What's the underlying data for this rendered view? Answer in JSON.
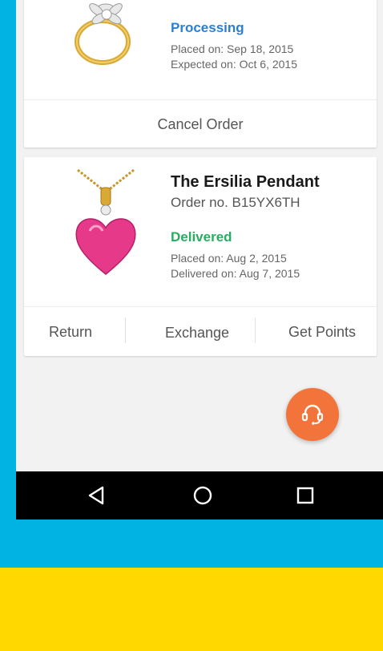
{
  "orders": [
    {
      "status": "Processing",
      "status_color": "#2a7fd4",
      "placed": "Placed on: Sep 18, 2015",
      "expected": "Expected on: Oct 6, 2015",
      "action": "Cancel Order",
      "image_icon": "flower-ring-icon"
    },
    {
      "title": "The Ersilia Pendant",
      "order_no": "Order no. B15YX6TH",
      "status": "Delivered",
      "status_color": "#27ae60",
      "placed": "Placed on: Aug 2, 2015",
      "delivered": "Delivered on: Aug 7, 2015",
      "actions": [
        "Return",
        "Exchange",
        "Get Points"
      ],
      "image_icon": "heart-pendant-icon"
    }
  ],
  "fab_icon": "headset-support-icon",
  "nav": [
    "back-icon",
    "home-icon",
    "recents-icon"
  ],
  "colors": {
    "accent_orange": "#f2743a",
    "background_blue": "#00b3e3",
    "background_yellow": "#ffd800"
  }
}
